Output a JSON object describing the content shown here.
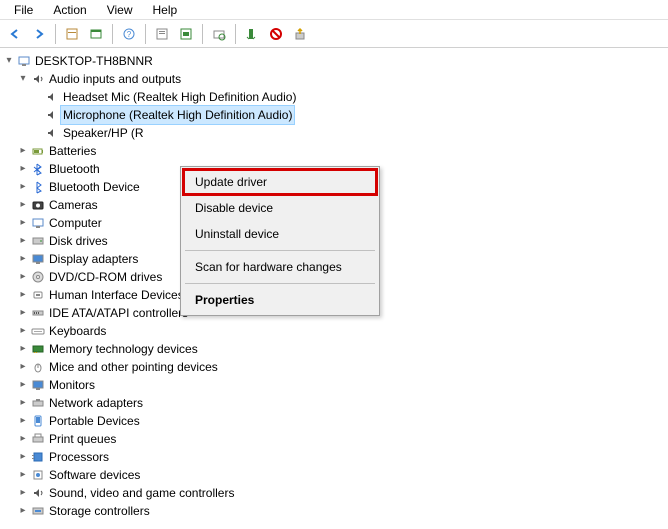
{
  "menubar": {
    "file": "File",
    "action": "Action",
    "view": "View",
    "help": "Help"
  },
  "root": {
    "name": "DESKTOP-TH8BNNR"
  },
  "audio": {
    "label": "Audio inputs and outputs",
    "children": [
      "Headset Mic (Realtek High Definition Audio)",
      "Microphone (Realtek High Definition Audio)",
      "Speaker/HP (R"
    ]
  },
  "categories": [
    "Batteries",
    "Bluetooth",
    "Bluetooth Device",
    "Cameras",
    "Computer",
    "Disk drives",
    "Display adapters",
    "DVD/CD-ROM drives",
    "Human Interface Devices",
    "IDE ATA/ATAPI controllers",
    "Keyboards",
    "Memory technology devices",
    "Mice and other pointing devices",
    "Monitors",
    "Network adapters",
    "Portable Devices",
    "Print queues",
    "Processors",
    "Software devices",
    "Sound, video and game controllers",
    "Storage controllers"
  ],
  "context_menu": {
    "update": "Update driver",
    "disable": "Disable device",
    "uninstall": "Uninstall device",
    "scan": "Scan for hardware changes",
    "properties": "Properties"
  }
}
